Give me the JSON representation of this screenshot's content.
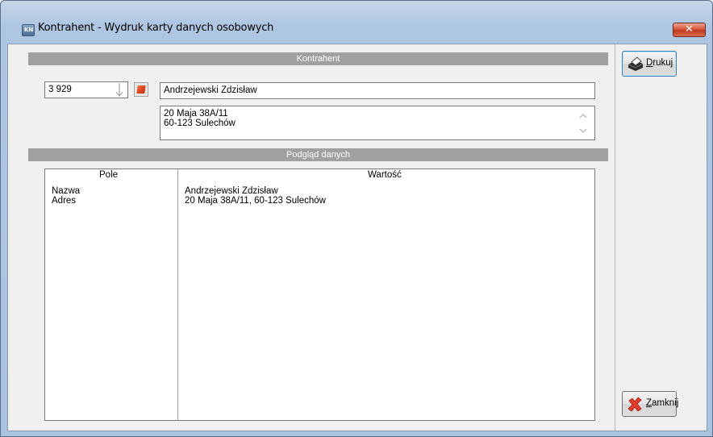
{
  "window": {
    "title": "Kontrahent - Wydruk karty danych osobowych",
    "close_glyph": "✕",
    "app_icon_text": "KN"
  },
  "kontrahent": {
    "section_label": "Kontrahent",
    "number": "3 929",
    "name": "Andrzejewski Zdzisław",
    "address_line1": "20 Maja 38A/11",
    "address_line2": "60-123 Sulechów"
  },
  "preview": {
    "section_label": "Podgląd danych",
    "columns": [
      "Pole",
      "Wartość"
    ],
    "rows": [
      [
        "Nazwa",
        "Andrzejewski Zdzisław"
      ],
      [
        "Adres",
        "20 Maja 38A/11, 60-123 Sulechów"
      ]
    ]
  },
  "buttons": {
    "print_label_first": "D",
    "print_label_rest": "rukuj",
    "close_label_first": "Z",
    "close_label_rest": "amknij"
  },
  "colors": {
    "section_bar": "#a0a0a0",
    "close_button": "#c03a1e"
  }
}
